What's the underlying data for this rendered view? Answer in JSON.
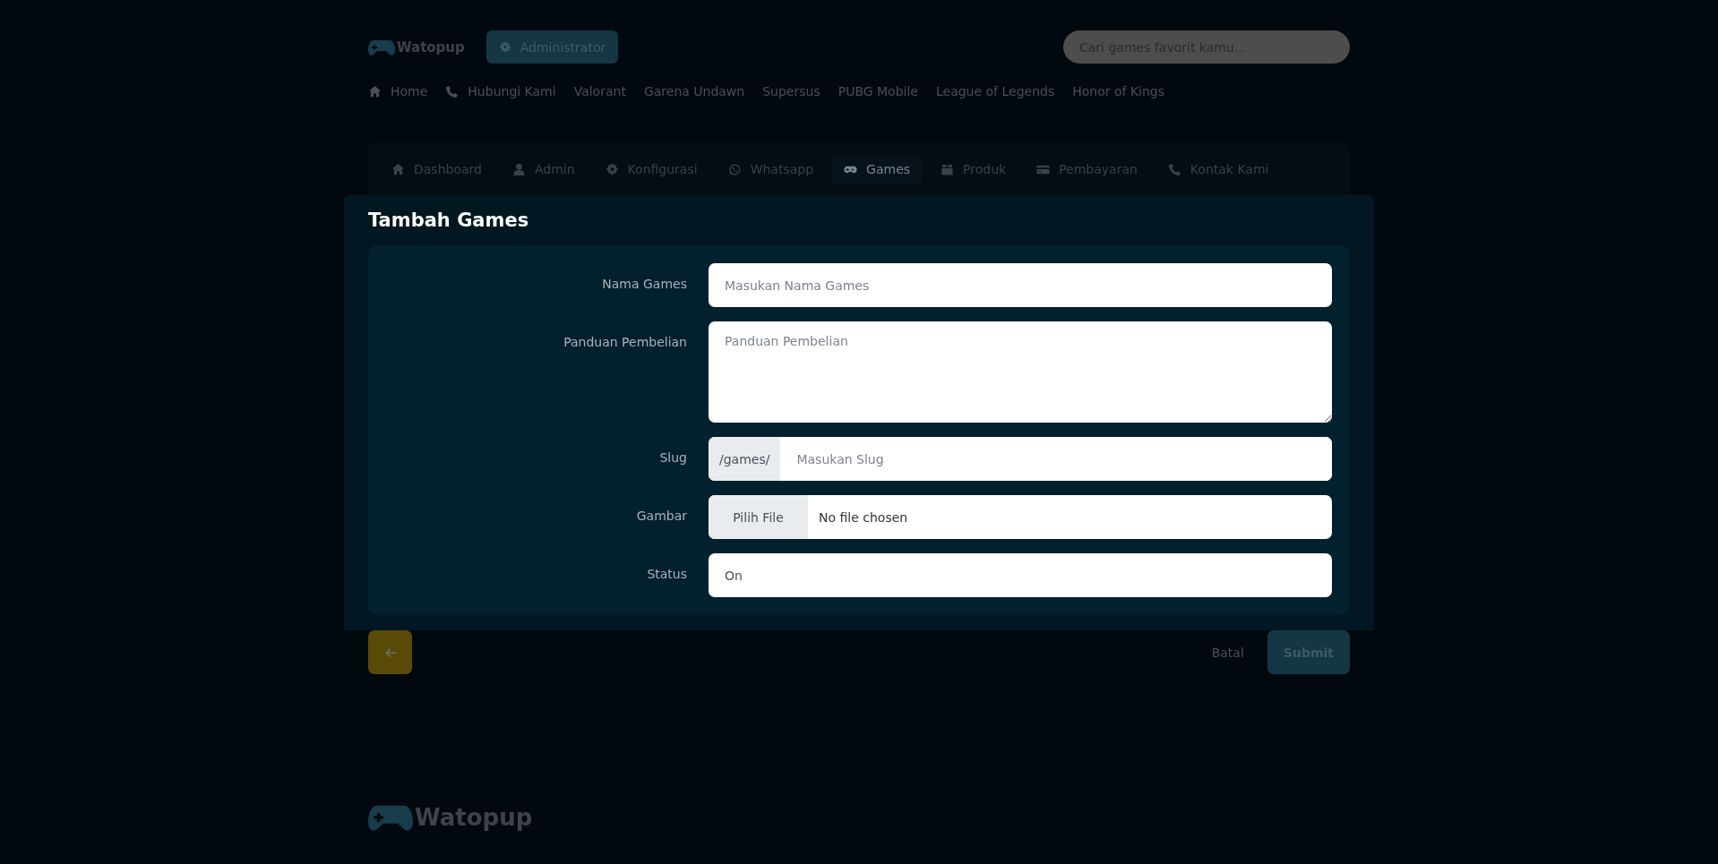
{
  "header": {
    "logo": "Watopup",
    "role_button": "Administrator",
    "search": {
      "placeholder": "Cari games favorit kamu..."
    }
  },
  "nav": [
    {
      "label": "Home",
      "kind": "icon-link"
    },
    {
      "label": "Hubungi Kami",
      "kind": "icon-link"
    },
    {
      "label": "Valorant",
      "kind": "link"
    },
    {
      "label": "Garena Undawn",
      "kind": "link"
    },
    {
      "label": "Supersus",
      "kind": "link"
    },
    {
      "label": "PUBG Mobile",
      "kind": "link"
    },
    {
      "label": "League of Legends",
      "kind": "link"
    },
    {
      "label": "Honor of Kings",
      "kind": "link"
    }
  ],
  "admin_tabs": [
    {
      "label": "Dashboard",
      "selected": false
    },
    {
      "label": "Admin",
      "selected": false
    },
    {
      "label": "Konfigurasi",
      "selected": false
    },
    {
      "label": "Whatsapp",
      "selected": false
    },
    {
      "label": "Games",
      "selected": true
    },
    {
      "label": "Produk",
      "selected": false
    },
    {
      "label": "Pembayaran",
      "selected": false
    },
    {
      "label": "Kontak Kami",
      "selected": false
    }
  ],
  "modal": {
    "title": "Tambah Games",
    "fields": [
      {
        "label": "Nama Games",
        "kind": "text",
        "placeholder": "Masukan Nama Games"
      },
      {
        "label": "Panduan Pembelian",
        "kind": "textarea",
        "placeholder": "Panduan Pembelian"
      },
      {
        "label": "Slug",
        "kind": "prefixed",
        "prefix": "/games/",
        "placeholder": "Masukan Slug"
      },
      {
        "label": "Gambar",
        "kind": "file",
        "button": "Pilih File",
        "value": "No file chosen"
      },
      {
        "label": "Status",
        "kind": "select",
        "value": "On"
      }
    ]
  },
  "actions": {
    "cancel": "Batal",
    "submit": "Submit"
  },
  "footer": {
    "logo": "Watopup"
  }
}
